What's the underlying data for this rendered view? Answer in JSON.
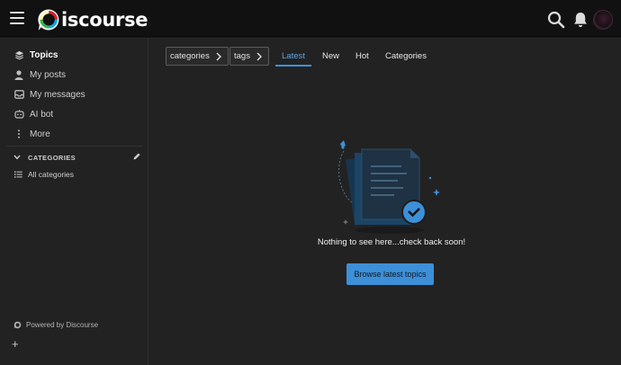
{
  "header": {
    "logo_text": "iscourse",
    "icons": [
      "menu-icon",
      "search-icon",
      "bell-icon",
      "user-avatar"
    ]
  },
  "sidebar": {
    "items": [
      {
        "label": "Topics",
        "icon": "layers-icon",
        "active": true
      },
      {
        "label": "My posts",
        "icon": "user-icon"
      },
      {
        "label": "My messages",
        "icon": "inbox-icon"
      },
      {
        "label": "AI bot",
        "icon": "robot-icon"
      },
      {
        "label": "More",
        "icon": "ellipsis-vertical-icon"
      }
    ],
    "categories_heading": "CATEGORIES",
    "categories": [
      {
        "label": "All categories",
        "icon": "list-icon"
      }
    ],
    "powered_by": "Powered by Discourse",
    "add_label": "+"
  },
  "main": {
    "filters": [
      {
        "label": "categories",
        "icon": "chevron-right-icon"
      },
      {
        "label": "tags",
        "icon": "chevron-right-icon"
      }
    ],
    "tabs": [
      {
        "label": "Latest",
        "active": true
      },
      {
        "label": "New"
      },
      {
        "label": "Hot"
      },
      {
        "label": "Categories"
      }
    ],
    "empty_message": "Nothing to see here...check back soon!",
    "browse_button": "Browse latest topics"
  },
  "colors": {
    "background": "#222222",
    "header": "#111111",
    "accent": "#3d8fd8",
    "active_tab": "#5ba4e5"
  }
}
